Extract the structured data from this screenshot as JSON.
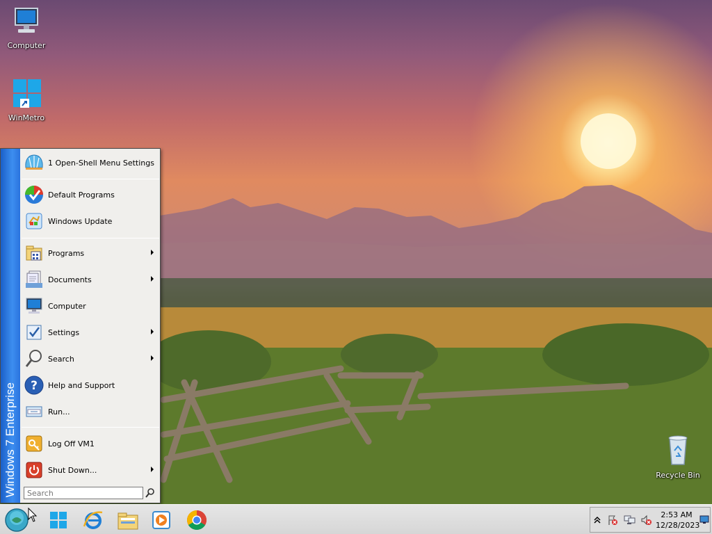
{
  "desktop": {
    "icons": [
      {
        "label": "Computer",
        "icon": "computer-icon"
      },
      {
        "label": "WinMetro",
        "icon": "windows-logo-icon"
      },
      {
        "label": "Recycle Bin",
        "icon": "recycle-bin-icon"
      }
    ]
  },
  "start_menu": {
    "banner": "Windows 7 Enterprise",
    "items": [
      {
        "label": "1 Open-Shell Menu Settings",
        "icon": "shell-icon",
        "submenu": false
      },
      {
        "label": "Default Programs",
        "icon": "default-programs-icon",
        "submenu": false
      },
      {
        "label": "Windows Update",
        "icon": "windows-update-icon",
        "submenu": false
      },
      {
        "label": "Programs",
        "icon": "programs-icon",
        "submenu": true
      },
      {
        "label": "Documents",
        "icon": "documents-icon",
        "submenu": true
      },
      {
        "label": "Computer",
        "icon": "computer-icon",
        "submenu": false
      },
      {
        "label": "Settings",
        "icon": "settings-icon",
        "submenu": true
      },
      {
        "label": "Search",
        "icon": "search-icon",
        "submenu": true
      },
      {
        "label": "Help and Support",
        "icon": "help-icon",
        "submenu": false
      },
      {
        "label": "Run...",
        "icon": "run-icon",
        "submenu": false
      },
      {
        "label": "Log Off VM1",
        "icon": "log-off-icon",
        "submenu": false
      },
      {
        "label": "Shut Down...",
        "icon": "shutdown-icon",
        "submenu": true
      }
    ],
    "search_placeholder": "Search"
  },
  "taskbar": {
    "pinned": [
      "start-orb",
      "winmetro",
      "internet-explorer",
      "file-explorer",
      "media-player",
      "chrome"
    ],
    "tray": {
      "time": "2:53 AM",
      "date": "12/28/2023"
    }
  },
  "colors": {
    "start_banner": "#2a73de",
    "menu_background": "#f0efec",
    "taskbar": "#dedede"
  }
}
